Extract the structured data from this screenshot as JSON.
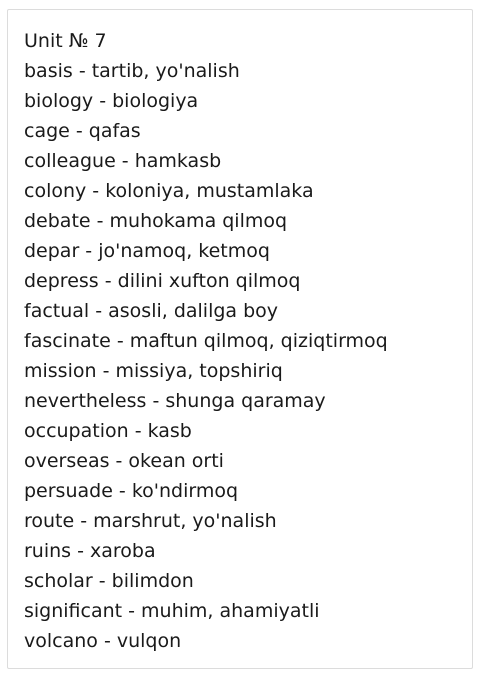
{
  "title": "Unit № 7",
  "words": [
    "basis - tartib, yo'nalish",
    "biology - biologiya",
    "cage - qafas",
    "colleague - hamkasb",
    "colony - koloniya, mustamlaka",
    "debate - muhokama qilmoq",
    "depar - jo'namoq, ketmoq",
    "depress - dilini xufton qilmoq",
    "factual - asosli, dalilga boy",
    "fascinate - maftun qilmoq, qiziqtirmoq",
    "mission - missiya, topshiriq",
    "nevertheless - shunga qaramay",
    "occupation - kasb",
    "overseas - okean orti",
    "persuade - ko'ndirmoq",
    "route - marshrut, yo'nalish",
    "ruins - xaroba",
    "scholar - bilimdon",
    "significant - muhim, ahamiyatli",
    "volcano - vulqon"
  ]
}
